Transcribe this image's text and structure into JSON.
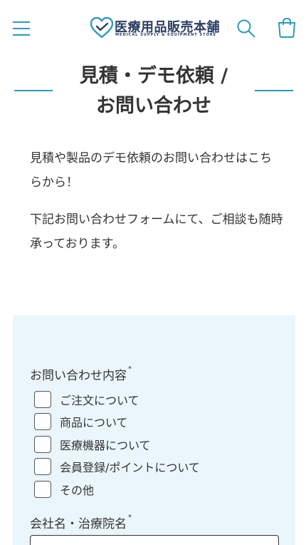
{
  "header": {
    "logo_text": "医療用品販売本舗",
    "logo_sub": "MEDICAL SUPPLY & EQUIPMENT STORE",
    "menu_icon": "hamburger-menu-icon",
    "search_icon": "search-icon",
    "cart_icon": "cart-icon",
    "accent_color": "#2a9bc1",
    "brand_color": "#2c3e63"
  },
  "page": {
    "title_line1": "見積・デモ依頼 /",
    "title_line2": "お問い合わせ"
  },
  "intro": {
    "para1": "見積や製品のデモ依頼のお問い合わせはこちらから！",
    "para2": "下記お問い合わせフォームにて、ご相談も随時承っております。"
  },
  "form": {
    "panel_color": "#eaf6fb",
    "inquiry_label": "お問い合わせ内容",
    "required_mark": "*",
    "options": [
      {
        "label": "ご注文について",
        "checked": false
      },
      {
        "label": "商品について",
        "checked": false
      },
      {
        "label": "医療機器について",
        "checked": false
      },
      {
        "label": "会員登録/ポイントについて",
        "checked": false
      },
      {
        "label": "その他",
        "checked": false
      }
    ],
    "company_label": "会社名・治療院名",
    "company_value": ""
  }
}
